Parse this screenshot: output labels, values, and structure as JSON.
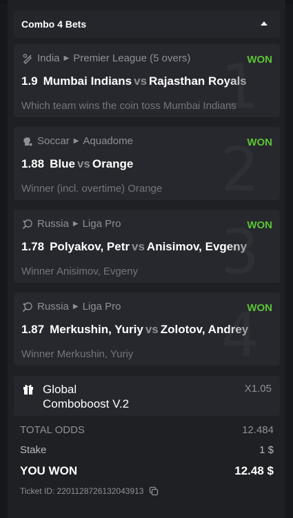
{
  "header": {
    "title": "Combo 4 Bets",
    "toggle_icon": "caret-up-icon"
  },
  "bets": [
    {
      "index": "1",
      "sport_icon": "cricket-icon",
      "sport": "India",
      "league": "Premier League (5 overs)",
      "status": "WON",
      "odds": "1.9",
      "team1": "Mumbai Indians",
      "vs": "vs",
      "team2": "Rajasthan Royals",
      "market": "Which team wins the coin toss Mumbai Indians"
    },
    {
      "index": "2",
      "sport_icon": "soccer-icon",
      "sport": "Soccar",
      "league": "Aquadome",
      "status": "WON",
      "odds": "1.88",
      "team1": "Blue",
      "vs": "vs",
      "team2": "Orange",
      "market": "Winner (incl. overtime) Orange"
    },
    {
      "index": "3",
      "sport_icon": "table-tennis-icon",
      "sport": "Russia",
      "league": "Liga Pro",
      "status": "WON",
      "odds": "1.78",
      "team1": "Polyakov, Petr",
      "vs": "vs",
      "team2": "Anisimov, Evgeny",
      "market": "Winner Anisimov, Evgeny"
    },
    {
      "index": "4",
      "sport_icon": "table-tennis-icon",
      "sport": "Russia",
      "league": "Liga Pro",
      "status": "WON",
      "odds": "1.87",
      "team1": "Merkushin, Yuriy",
      "vs": "vs",
      "team2": "Zolotov, Andrey",
      "market": "Winner Merkushin, Yuriy"
    }
  ],
  "boost": {
    "icon": "gift-icon",
    "line1": "Global",
    "line2": "Comboboost V.2",
    "multiplier": "X1.05"
  },
  "summary": {
    "total_odds_label": "TOTAL ODDS",
    "total_odds_value": "12.484",
    "stake_label": "Stake",
    "stake_value": "1 $",
    "won_label": "YOU WON",
    "won_value": "12.48 $"
  },
  "ticket": {
    "label": "Ticket ID: 2201128726132043913",
    "copy_icon": "copy-icon"
  },
  "colors": {
    "won": "#5ac435",
    "background": "#17181c",
    "card": "#27282d",
    "muted": "#8f9096"
  }
}
